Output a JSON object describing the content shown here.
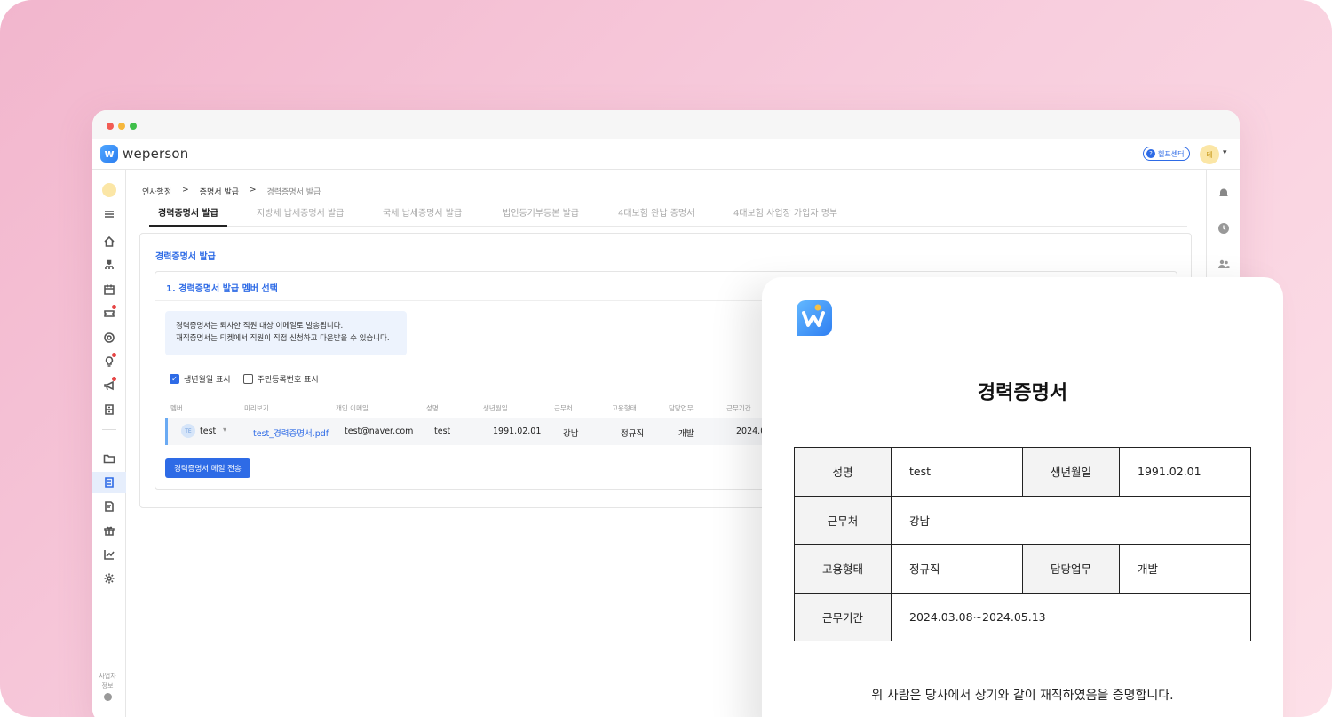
{
  "app": {
    "brand": "weperson",
    "help_label": "헬프센터",
    "avatar_initial": "테"
  },
  "breadcrumb": [
    "인사행정",
    "증명서 발급",
    "경력증명서 발급"
  ],
  "breadcrumb_sep": ">",
  "tabs": [
    "경력증명서 발급",
    "지방세 납세증명서 발급",
    "국세 납세증명서 발급",
    "법인등기부등본 발급",
    "4대보험 완납 증명서",
    "4대보험 사업장 가입자 명부"
  ],
  "panel": {
    "title": "경력증명서 발급",
    "section_title": "1. 경력증명서 발급 멤버 선택",
    "notice_line1": "경력증명서는 퇴사한 직원 대상 이메일로 발송됩니다.",
    "notice_line2": "재직증명서는 티켓에서 직원이 직접 신청하고 다운받을 수 있습니다.",
    "check_birth": "생년월일 표시",
    "check_rrn": "주민등록번호 표시",
    "send_button": "경력증명서 메일 전송"
  },
  "table": {
    "headers": [
      "멤버",
      "미리보기",
      "개인 이메일",
      "성명",
      "생년월일",
      "근무처",
      "고용형태",
      "담당업무",
      "근무기간"
    ],
    "row": {
      "avatar": "TE",
      "member": "test",
      "preview": "test_경력증명서.pdf",
      "email": "test@naver.com",
      "name": "test",
      "birth": "1991.02.01",
      "workplace": "강남",
      "employment": "정규직",
      "duty": "개발",
      "period": "2024.0"
    }
  },
  "sidebar": {
    "bottom_label_1": "사업자",
    "bottom_label_2": "정보"
  },
  "certificate": {
    "title": "경력증명서",
    "labels": {
      "name": "성명",
      "birth": "생년월일",
      "workplace": "근무처",
      "employment": "고용형태",
      "duty": "담당업무",
      "period": "근무기간"
    },
    "values": {
      "name": "test",
      "birth": "1991.02.01",
      "workplace": "강남",
      "employment": "정규직",
      "duty": "개발",
      "period": "2024.03.08~2024.05.13"
    },
    "footer": "위 사람은 당사에서 상기와 같이 재직하였음을 증명합니다."
  },
  "colors": {
    "accent": "#2e6be6",
    "background_pink": "#f7cbdc"
  }
}
